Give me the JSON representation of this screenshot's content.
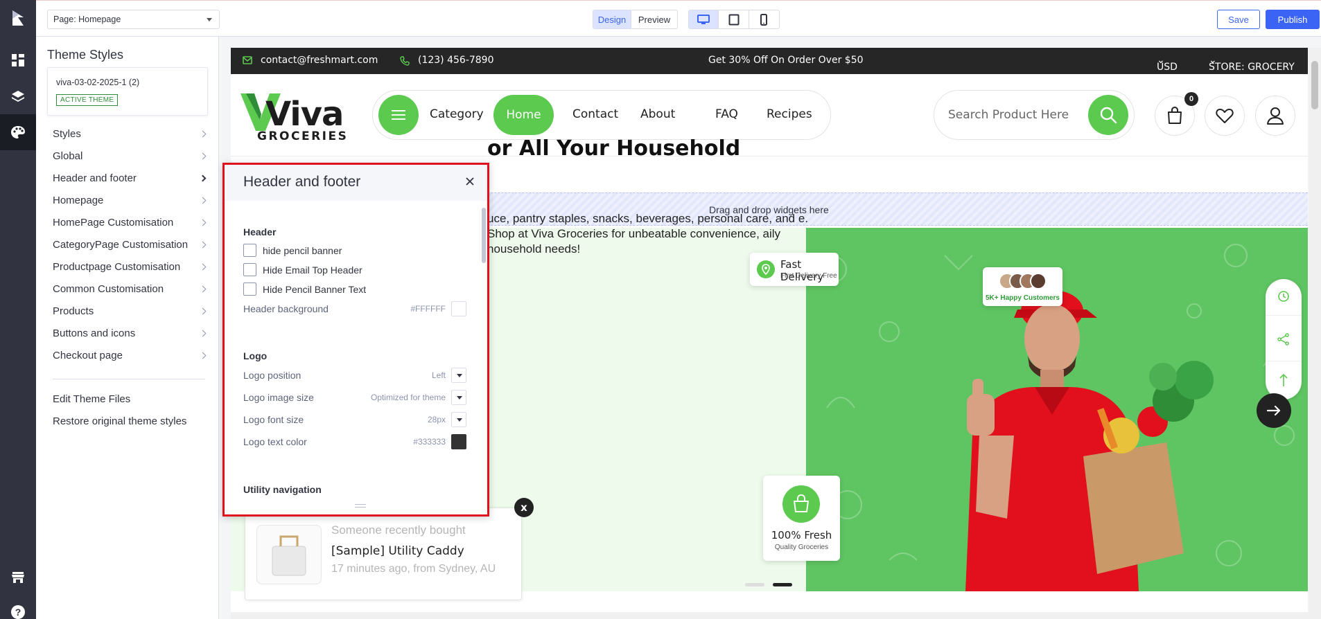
{
  "topbar": {
    "page_select": "Page: Homepage",
    "design_label": "Design",
    "preview_label": "Preview",
    "save_label": "Save",
    "publish_label": "Publish",
    "devices": [
      "desktop-icon",
      "tablet-icon",
      "mobile-icon"
    ],
    "active_device": "desktop"
  },
  "rail": {
    "icons": [
      "bigcommerce-logo-icon",
      "widgets-icon",
      "layers-icon",
      "palette-icon",
      "storefront-icon",
      "help-icon"
    ]
  },
  "sidebar": {
    "title": "Theme Styles",
    "theme_name": "viva-03-02-2025-1 (2)",
    "theme_badge": "ACTIVE THEME",
    "items": [
      {
        "label": "Styles"
      },
      {
        "label": "Global"
      },
      {
        "label": "Header and footer"
      },
      {
        "label": "Homepage"
      },
      {
        "label": "HomePage Customisation"
      },
      {
        "label": "CategoryPage Customisation"
      },
      {
        "label": "Productpage Customisation"
      },
      {
        "label": "Common Customisation"
      },
      {
        "label": "Products"
      },
      {
        "label": "Buttons and icons"
      },
      {
        "label": "Checkout page"
      }
    ],
    "links": [
      "Edit Theme Files",
      "Restore original theme styles"
    ]
  },
  "store": {
    "email": "contact@freshmart.com",
    "phone": "(123) 456-7890",
    "promo": "Get 30% Off On Order Over $50",
    "currency": "USD",
    "store_label": "STORE: GROCERY",
    "logo_word": "Viva",
    "logo_sub": "GROCERIES",
    "nav": [
      "Category",
      "Home",
      "Contact",
      "About",
      "FAQ",
      "Recipes"
    ],
    "search_placeholder": "Search Product Here",
    "cart_count": "0",
    "dropzone": "Drag and drop widgets here",
    "hero_title": "or All Your Household",
    "hero_text": "uce, pantry staples, snacks, beverages, personal care, and e. Shop at Viva Groceries for unbeatable convenience, aily household needs!",
    "card_delivery_title": "Fast Delivery",
    "card_delivery_sub": "First Delivery Free",
    "card_customers": "5K+ Happy Customers",
    "card_fresh_title": "100% Fresh",
    "card_fresh_sub": "Quality Groceries",
    "accent_color": "#5cc94f"
  },
  "panel": {
    "title": "Header and footer",
    "header_section": "Header",
    "checks": [
      "hide pencil banner",
      "Hide Email Top Header",
      "Hide Pencil Banner Text"
    ],
    "header_bg_label": "Header background",
    "header_bg_value": "#FFFFFF",
    "logo_section": "Logo",
    "logo_position_label": "Logo position",
    "logo_position_value": "Left",
    "logo_image_size_label": "Logo image size",
    "logo_image_size_value": "Optimized for theme",
    "logo_font_size_label": "Logo font size",
    "logo_font_size_value": "28px",
    "logo_text_color_label": "Logo text color",
    "logo_text_color_value": "#333333",
    "utility_section": "Utility navigation"
  },
  "toast": {
    "line1": "Someone recently bought",
    "product": "[Sample] Utility Caddy",
    "line3": "17 minutes ago, from Sydney, AU",
    "close": "x"
  }
}
